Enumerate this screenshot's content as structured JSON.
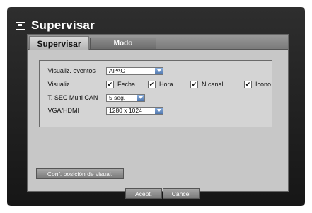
{
  "window": {
    "title": "Supervisar"
  },
  "tabs": [
    {
      "label": "Supervisar",
      "active": true
    },
    {
      "label": "Modo",
      "active": false
    }
  ],
  "settings": {
    "event_display": {
      "label": "· Visualiz. eventos",
      "value": "APAG"
    },
    "display": {
      "label": "· Visualiz.",
      "options": [
        {
          "label": "Fecha",
          "checked": true
        },
        {
          "label": "Hora",
          "checked": true
        },
        {
          "label": "N.canal",
          "checked": true
        },
        {
          "label": "Icono",
          "checked": true
        }
      ]
    },
    "multi_can_seq": {
      "label": "· T. SEC Multi CAN",
      "value": "5 seg."
    },
    "vga_hdmi": {
      "label": "· VGA/HDMI",
      "value": "1280 x 1024"
    }
  },
  "buttons": {
    "position_config": "Conf. posición de visual.",
    "accept": "Acept.",
    "cancel": "Cancel"
  },
  "colors": {
    "frame_bg": "#1d1d1d",
    "panel_bg": "#c7c7c7",
    "dropdown_arrow": "#4f76ad"
  }
}
